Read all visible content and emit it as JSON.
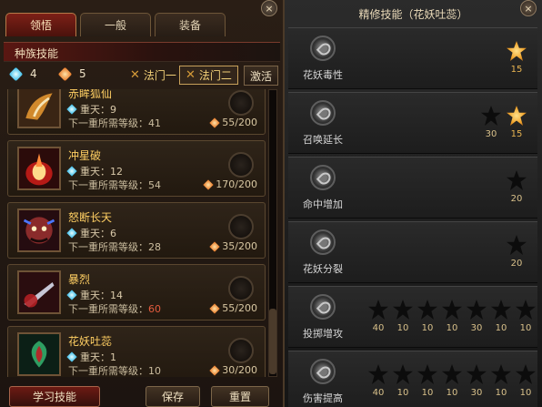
{
  "left": {
    "tabs": [
      "领悟",
      "一般",
      "装备"
    ],
    "close": "×",
    "race_bar": "种族技能",
    "resources": {
      "blue": "4",
      "orange": "5"
    },
    "laws": {
      "one": "法门一",
      "two": "法门二"
    },
    "activate": "激活",
    "skills": [
      {
        "name": "赤眸狐仙",
        "tier": "重天：9",
        "req_label": "下一重所需等级：",
        "req_value": "41",
        "cost": "55/200",
        "icon": "fox-skill-icon"
      },
      {
        "name": "冲星破",
        "tier": "重天：12",
        "req_label": "下一重所需等级：",
        "req_value": "54",
        "cost": "170/200",
        "icon": "fire-burst-icon"
      },
      {
        "name": "怒断长天",
        "tier": "重天：6",
        "req_label": "下一重所需等级：",
        "req_value": "28",
        "cost": "35/200",
        "icon": "demon-face-icon"
      },
      {
        "name": "暴烈",
        "tier": "重天：14",
        "req_label": "下一重所需等级：",
        "req_value": "60",
        "cost": "55/200",
        "icon": "blade-icon",
        "req_red": true
      },
      {
        "name": "花妖吐蕊",
        "tier": "重天：1",
        "req_label": "下一重所需等级：",
        "req_value": "10",
        "cost": "30/200",
        "icon": "green-flower-icon"
      }
    ],
    "buttons": {
      "learn": "学习技能",
      "save": "保存",
      "reset": "重置"
    }
  },
  "right": {
    "title": "精修技能（花妖吐蕊）",
    "close": "×",
    "rows": [
      {
        "name": "花妖毒性",
        "nodes": [
          {
            "value": "15",
            "lit": true
          }
        ]
      },
      {
        "name": "召唤延长",
        "nodes": [
          {
            "value": "30",
            "lit": false
          },
          {
            "value": "15",
            "lit": true
          }
        ]
      },
      {
        "name": "命中增加",
        "nodes": [
          {
            "value": "20",
            "lit": false
          }
        ]
      },
      {
        "name": "花妖分裂",
        "nodes": [
          {
            "value": "20",
            "lit": false
          }
        ]
      },
      {
        "name": "投掷增攻",
        "nodes": [
          {
            "value": "40",
            "lit": false
          },
          {
            "value": "10",
            "lit": false
          },
          {
            "value": "10",
            "lit": false
          },
          {
            "value": "10",
            "lit": false
          },
          {
            "value": "30",
            "lit": false
          },
          {
            "value": "10",
            "lit": false
          },
          {
            "value": "10",
            "lit": false
          }
        ]
      },
      {
        "name": "伤害提高",
        "nodes": [
          {
            "value": "40",
            "lit": false
          },
          {
            "value": "10",
            "lit": false
          },
          {
            "value": "10",
            "lit": false
          },
          {
            "value": "10",
            "lit": false
          },
          {
            "value": "30",
            "lit": false
          },
          {
            "value": "10",
            "lit": false
          },
          {
            "value": "10",
            "lit": false
          }
        ]
      }
    ]
  },
  "colors": {
    "accent_red": "#7d2017",
    "gold": "#ffcf63",
    "star_gold": "#f0a32a",
    "panel_dark": "#1c1410"
  }
}
